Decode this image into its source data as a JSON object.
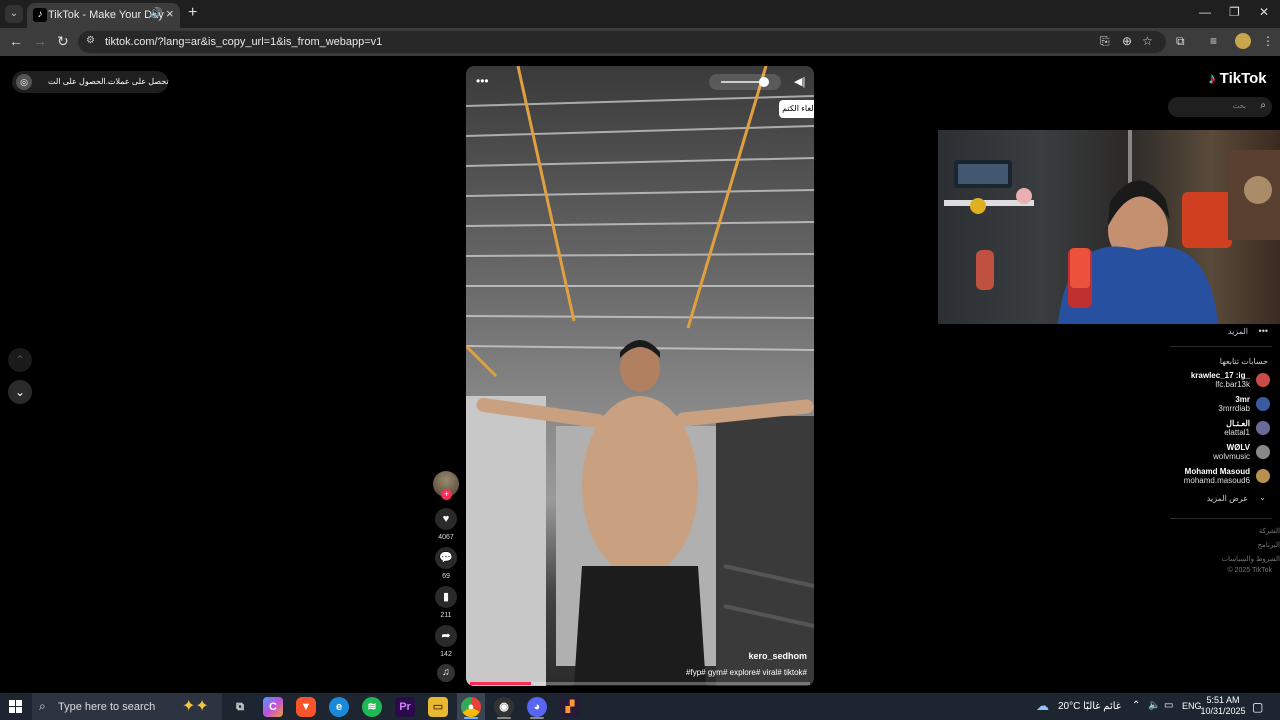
{
  "browser": {
    "tab_title": "TikTok - Make Your Day",
    "url": "tiktok.com/?lang=ar&is_copy_url=1&is_from_webapp=v1"
  },
  "page": {
    "get_app": {
      "left_label": "الحصول على الت...",
      "right_label": "تحصل على عملات"
    },
    "logo_text": "TikTok",
    "search_placeholder": "بحث",
    "video": {
      "unmute_tooltip": "إلغاء الكتم",
      "author": "kero_sedhom",
      "caption": "#fyp# gym# explore# viral# tiktok#",
      "progress_fraction": 0.18
    },
    "actions": {
      "likes": "4067",
      "comments": "69",
      "saves": "211",
      "shares": "142"
    },
    "sidebar": {
      "more_label": "المزيد",
      "following_title": "حسابات تتابعها",
      "accounts": [
        {
          "name": "krawlec_17 :ig_",
          "user": "lfc.bar13k",
          "color": "#c94a4a"
        },
        {
          "name": "3mr",
          "user": "3mrrdiab",
          "color": "#3a5aa0"
        },
        {
          "name": "العـتـال",
          "user": "elattal1",
          "color": "#6a6a9a"
        },
        {
          "name": "WØLV",
          "user": "wolvmusic",
          "color": "#888888"
        },
        {
          "name": "Mohamd Masoud",
          "user": "mohamd.masoud6",
          "color": "#b89050"
        }
      ],
      "see_more": "عرض المزيد",
      "footer": [
        "الشركة",
        "البرنامج",
        "الشروط والسياسات",
        "© 2025 TikTok"
      ]
    }
  },
  "taskbar": {
    "search_text": "Type here to search",
    "weather": "20°C  غائم غالبًا",
    "lang": "ENG",
    "time": "5:51 AM",
    "date": "10/31/2025"
  }
}
